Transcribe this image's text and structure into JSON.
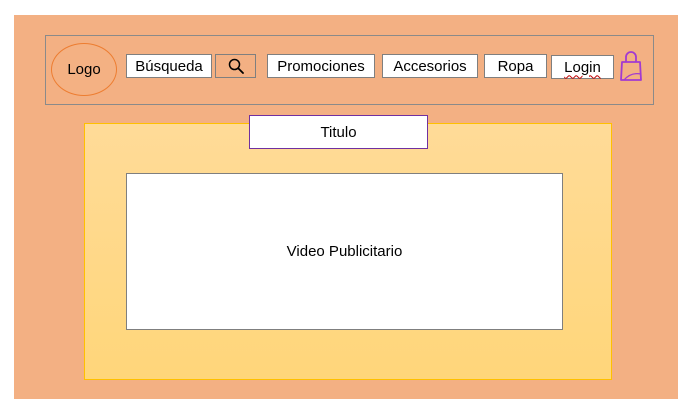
{
  "header": {
    "logo_label": "Logo",
    "search_label": "Búsqueda",
    "search_icon": "search-icon",
    "nav": [
      "Promociones",
      "Accesorios",
      "Ropa"
    ],
    "login_label": "Login",
    "cart_icon": "shopping-bag-icon"
  },
  "main": {
    "title_label": "Titulo",
    "video_label": "Video Publicitario"
  },
  "colors": {
    "background": "#f3b083",
    "panel": "#ffd98e",
    "panel_border": "#ffc000",
    "logo_border": "#ed7d31",
    "bag": "#a23ad1"
  }
}
